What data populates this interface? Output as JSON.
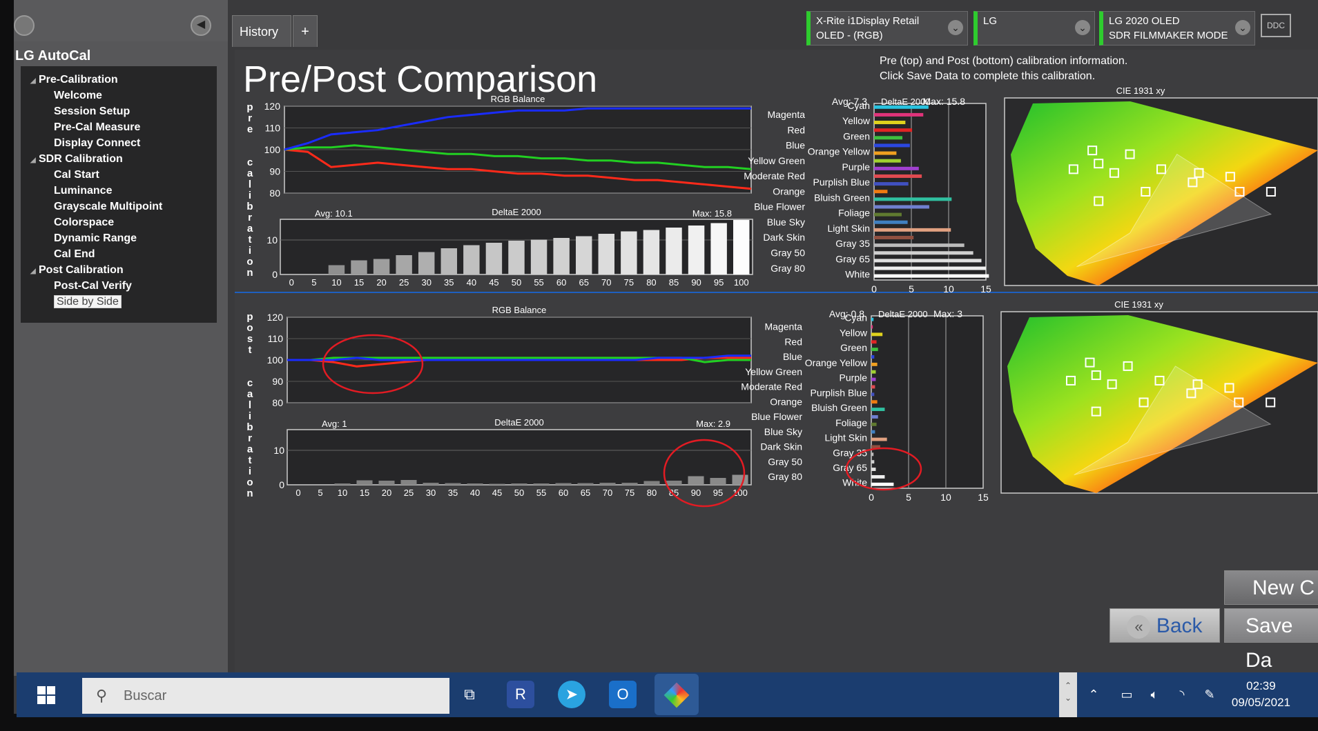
{
  "sidebar": {
    "title": "LG AutoCal",
    "items": [
      {
        "label": "Pre-Calibration",
        "type": "h"
      },
      {
        "label": "Welcome",
        "type": "c"
      },
      {
        "label": "Session Setup",
        "type": "c"
      },
      {
        "label": "Pre-Cal Measure",
        "type": "c"
      },
      {
        "label": "Display  Connect",
        "type": "c"
      },
      {
        "label": "SDR Calibration",
        "type": "h"
      },
      {
        "label": "Cal Start",
        "type": "c"
      },
      {
        "label": "Luminance",
        "type": "c"
      },
      {
        "label": "Grayscale Multipoint",
        "type": "c"
      },
      {
        "label": "Colorspace",
        "type": "c"
      },
      {
        "label": "Dynamic Range",
        "type": "c"
      },
      {
        "label": "Cal End",
        "type": "c"
      },
      {
        "label": "Post Calibration",
        "type": "h"
      },
      {
        "label": "Post-Cal Verify",
        "type": "c"
      },
      {
        "label": "Side by Side",
        "type": "c",
        "selected": true
      }
    ]
  },
  "tabs": {
    "history": "History 1",
    "add": "+"
  },
  "devices": [
    {
      "line1": "X-Rite i1Display Retail",
      "line2": "OLED - (RGB)"
    },
    {
      "line1": "LG",
      "line2": ""
    },
    {
      "line1": "LG 2020 OLED",
      "line2": "SDR FILMMAKER MODE"
    }
  ],
  "ddc": "DDC",
  "page_title": "Pre/Post Comparison",
  "info": {
    "line1": "Pre (top) and Post (bottom) calibration information.",
    "line2": "Click Save Data to complete this calibration."
  },
  "pre_label": "pre calibration",
  "post_label": "post calibration",
  "buttons": {
    "new": "New C",
    "back": "Back",
    "save": "Save Da"
  },
  "taskbar": {
    "search": "Buscar",
    "time": "02:39",
    "date": "09/05/2021"
  },
  "colors": {
    "red": "#ff2a1a",
    "green": "#22d022",
    "blue": "#1a2cff",
    "accent": "#2ecc2e"
  },
  "chart_data": [
    {
      "id": "pre_rgb",
      "type": "line",
      "title": "RGB Balance",
      "ylim": [
        80,
        120
      ],
      "yticks": [
        80,
        90,
        100,
        110,
        120
      ],
      "x": [
        0,
        5,
        10,
        15,
        20,
        25,
        30,
        35,
        40,
        45,
        50,
        55,
        60,
        65,
        70,
        75,
        80,
        85,
        90,
        95,
        100
      ],
      "series": [
        {
          "name": "R",
          "color": "#ff2a1a",
          "values": [
            100,
            99,
            92,
            93,
            94,
            93,
            92,
            91,
            91,
            90,
            89,
            89,
            88,
            88,
            87,
            86,
            86,
            85,
            84,
            83,
            82
          ]
        },
        {
          "name": "G",
          "color": "#22d022",
          "values": [
            100,
            101,
            101,
            102,
            101,
            100,
            99,
            98,
            98,
            97,
            97,
            96,
            96,
            95,
            95,
            94,
            94,
            93,
            92,
            92,
            91
          ]
        },
        {
          "name": "B",
          "color": "#1a2cff",
          "values": [
            100,
            103,
            107,
            108,
            109,
            111,
            113,
            115,
            116,
            117,
            118,
            118,
            118,
            119,
            119,
            119,
            119,
            119,
            119,
            119,
            119
          ]
        }
      ]
    },
    {
      "id": "pre_de",
      "type": "bar",
      "title": "DeltaE 2000",
      "avg": "Avg: 10.1",
      "max": "Max: 15.8",
      "ylim": [
        0,
        16
      ],
      "yticks": [
        0,
        10
      ],
      "categories": [
        "0",
        "5",
        "10",
        "15",
        "20",
        "25",
        "30",
        "35",
        "40",
        "45",
        "50",
        "55",
        "60",
        "65",
        "70",
        "75",
        "80",
        "85",
        "90",
        "95",
        "100"
      ],
      "values": [
        0,
        0,
        2.7,
        4.1,
        4.5,
        5.6,
        6.5,
        7.6,
        8.5,
        9.2,
        9.8,
        10.1,
        10.6,
        11.1,
        11.8,
        12.5,
        12.9,
        13.6,
        14.2,
        14.9,
        15.8
      ]
    },
    {
      "id": "pre_color",
      "type": "bar",
      "title": "DeltaE 2000",
      "avg": "Avg: 7.3",
      "max": "Max: 15.8",
      "xlim": [
        0,
        15
      ],
      "xticks": [
        0,
        5,
        10,
        15
      ],
      "categories": [
        "Cyan",
        "Magenta",
        "Yellow",
        "Red",
        "Green",
        "Blue",
        "Orange Yellow",
        "Yellow Green",
        "Purple",
        "Moderate Red",
        "Purplish Blue",
        "Orange",
        "Bluish Green",
        "Blue Flower",
        "Foliage",
        "Blue Sky",
        "Light Skin",
        "Dark Skin",
        "Gray 35",
        "Gray 50",
        "Gray 65",
        "Gray 80",
        "White"
      ],
      "values": [
        7.3,
        6.6,
        4.2,
        5.1,
        3.8,
        4.8,
        3.0,
        3.6,
        6.0,
        6.4,
        4.6,
        1.8,
        10.4,
        7.4,
        3.7,
        4.5,
        10.3,
        5.3,
        12.1,
        13.3,
        14.4,
        15.0,
        15.4
      ],
      "bar_colors": [
        "#29c3e0",
        "#e0337a",
        "#e0d21d",
        "#e02424",
        "#3ec03e",
        "#2b47e0",
        "#f0a020",
        "#a0d030",
        "#a040d0",
        "#e04a50",
        "#4050c0",
        "#f07a10",
        "#30c0a0",
        "#7080d0",
        "#607a30",
        "#4080c0",
        "#e0a080",
        "#905040",
        "#bbbbbb",
        "#d0d0d0",
        "#e0e0e0",
        "#eeeeee",
        "#ffffff"
      ]
    },
    {
      "id": "post_rgb",
      "type": "line",
      "title": "RGB Balance",
      "ylim": [
        80,
        120
      ],
      "yticks": [
        80,
        90,
        100,
        110,
        120
      ],
      "x": [
        0,
        5,
        10,
        15,
        20,
        25,
        30,
        35,
        40,
        45,
        50,
        55,
        60,
        65,
        70,
        75,
        80,
        85,
        90,
        95,
        100
      ],
      "series": [
        {
          "name": "R",
          "color": "#ff2a1a",
          "values": [
            100,
            100,
            99,
            97,
            98,
            99,
            100,
            100,
            100,
            100,
            100,
            100,
            100,
            100,
            100,
            100,
            100,
            100,
            101,
            101,
            101
          ]
        },
        {
          "name": "G",
          "color": "#22d022",
          "values": [
            100,
            100,
            101,
            101,
            101,
            101,
            101,
            101,
            101,
            101,
            101,
            101,
            101,
            101,
            101,
            101,
            101,
            101,
            99,
            100,
            100
          ]
        },
        {
          "name": "B",
          "color": "#1a2cff",
          "values": [
            100,
            100,
            100,
            101,
            100,
            100,
            100,
            100,
            100,
            100,
            100,
            100,
            100,
            100,
            100,
            100,
            101,
            101,
            101,
            102,
            102
          ]
        }
      ]
    },
    {
      "id": "post_de",
      "type": "bar",
      "title": "DeltaE 2000",
      "avg": "Avg: 1",
      "max": "Max: 2.9",
      "ylim": [
        0,
        16
      ],
      "yticks": [
        0,
        10
      ],
      "categories": [
        "0",
        "5",
        "10",
        "15",
        "20",
        "25",
        "30",
        "35",
        "40",
        "45",
        "50",
        "55",
        "60",
        "65",
        "70",
        "75",
        "80",
        "85",
        "90",
        "95",
        "100"
      ],
      "values": [
        0,
        0,
        0.4,
        1.3,
        1.2,
        1.4,
        0.6,
        0.5,
        0.4,
        0.3,
        0.4,
        0.4,
        0.5,
        0.5,
        0.6,
        0.6,
        1.1,
        1.2,
        2.5,
        2.0,
        2.9
      ]
    },
    {
      "id": "post_color",
      "type": "bar",
      "title": "DeltaE 2000",
      "avg": "Avg: 0.8",
      "max": "Max: 3",
      "xlim": [
        0,
        15
      ],
      "xticks": [
        0,
        5,
        10,
        15
      ],
      "categories": [
        "Cyan",
        "Magenta",
        "Yellow",
        "Red",
        "Green",
        "Blue",
        "Orange Yellow",
        "Yellow Green",
        "Purple",
        "Moderate Red",
        "Purplish Blue",
        "Orange",
        "Bluish Green",
        "Blue Flower",
        "Foliage",
        "Blue Sky",
        "Light Skin",
        "Dark Skin",
        "Gray 35",
        "Gray 50",
        "Gray 65",
        "Gray 80",
        "White"
      ],
      "values": [
        0.3,
        0.2,
        1.5,
        0.7,
        0.9,
        0.4,
        0.8,
        0.6,
        0.6,
        0.5,
        0.4,
        0.8,
        1.8,
        0.9,
        0.7,
        0.5,
        2.1,
        1.2,
        0.3,
        0.4,
        0.6,
        1.8,
        3.0
      ],
      "bar_colors": [
        "#29c3e0",
        "#e0337a",
        "#e0d21d",
        "#e02424",
        "#3ec03e",
        "#2b47e0",
        "#f0a020",
        "#a0d030",
        "#a040d0",
        "#e04a50",
        "#4050c0",
        "#f07a10",
        "#30c0a0",
        "#7080d0",
        "#607a30",
        "#4080c0",
        "#e0a080",
        "#905040",
        "#bbbbbb",
        "#d0d0d0",
        "#e0e0e0",
        "#eeeeee",
        "#ffffff"
      ]
    }
  ],
  "cie_title": "CIE 1931 xy",
  "left_color_labels": [
    "Magenta",
    "Red",
    "Blue",
    "Yellow Green",
    "Moderate Red",
    "Orange",
    "Blue Flower",
    "Blue Sky",
    "Dark Skin",
    "Gray 50",
    "Gray 80"
  ],
  "right_color_labels": [
    "Cyan",
    "Yellow",
    "Green",
    "Orange Yellow",
    "Purple",
    "Purplish Blue",
    "Bluish Green",
    "Foliage",
    "Light Skin",
    "Gray 35",
    "Gray 65",
    "White"
  ]
}
